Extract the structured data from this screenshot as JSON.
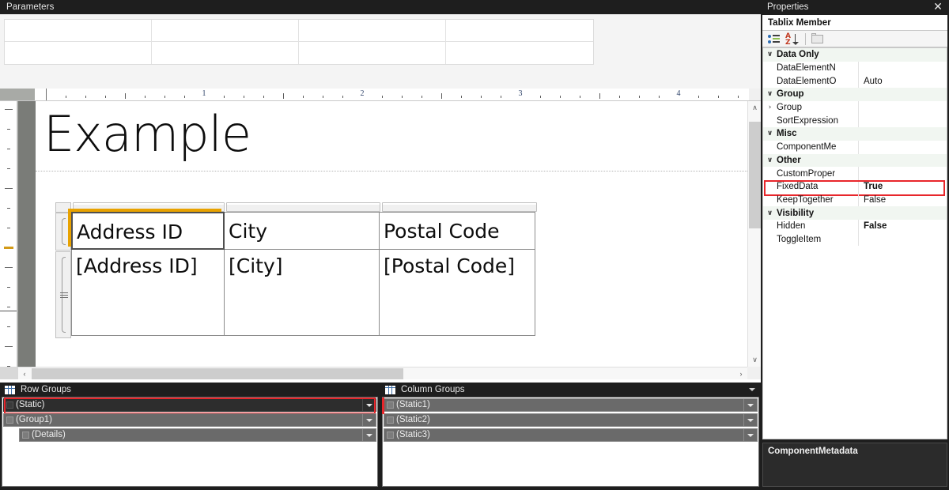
{
  "parameters_pane": {
    "title": "Parameters",
    "grid": {
      "columns": 4,
      "rows": 2,
      "cells": [
        "",
        "",
        "",
        "",
        "",
        "",
        "",
        ""
      ]
    }
  },
  "ruler": {
    "horizontal_labels": [
      "1",
      "2",
      "3",
      "4"
    ],
    "units": "inches"
  },
  "design_surface": {
    "report_title": "Example",
    "tablix": {
      "header_row": [
        "Address ID",
        "City",
        "Postal Code"
      ],
      "detail_row": [
        "[Address ID]",
        "[City]",
        "[Postal Code]"
      ],
      "selected_cell": "Address ID",
      "selection_color": "#e8a200"
    },
    "scrollbars": {
      "vertical_up": "∧",
      "vertical_down": "∨",
      "horizontal_left": "‹",
      "horizontal_right": "›"
    }
  },
  "row_groups": {
    "title": "Row Groups",
    "icon": "grid-icon",
    "rows": [
      {
        "label": "(Static)",
        "selected": true,
        "indent": 0,
        "highlighted": true
      },
      {
        "label": "(Group1)",
        "selected": false,
        "indent": 0,
        "highlighted": false
      },
      {
        "label": "(Details)",
        "selected": false,
        "indent": 1,
        "highlighted": false
      }
    ]
  },
  "column_groups": {
    "title": "Column Groups",
    "icon": "grid-icon",
    "rows": [
      {
        "label": "(Static1)",
        "selected": false,
        "indent": 0,
        "highlighted": false
      },
      {
        "label": "(Static2)",
        "selected": false,
        "indent": 0,
        "highlighted": false
      },
      {
        "label": "(Static3)",
        "selected": false,
        "indent": 0,
        "highlighted": false
      }
    ]
  },
  "properties_panel": {
    "title": "Properties",
    "close_glyph": "✕",
    "subtitle": "Tablix Member",
    "toolbar": {
      "categorized_tooltip": "Categorized",
      "alphabetical_tooltip": "Alphabetical",
      "property_pages_tooltip": "Property Pages"
    },
    "rows": [
      {
        "kind": "category",
        "expander": "∨",
        "name": "Data Only",
        "value": "",
        "bold_value": false,
        "highlighted": false
      },
      {
        "kind": "prop",
        "expander": "",
        "name": "DataElementN",
        "value": "",
        "bold_value": false,
        "highlighted": false
      },
      {
        "kind": "prop",
        "expander": "",
        "name": "DataElementO",
        "value": "Auto",
        "bold_value": false,
        "highlighted": false
      },
      {
        "kind": "category",
        "expander": "∨",
        "name": "Group",
        "value": "",
        "bold_value": false,
        "highlighted": false
      },
      {
        "kind": "prop",
        "expander": "›",
        "name": "Group",
        "value": "",
        "bold_value": false,
        "highlighted": false
      },
      {
        "kind": "prop",
        "expander": "",
        "name": "SortExpression",
        "value": "",
        "bold_value": false,
        "highlighted": false
      },
      {
        "kind": "category",
        "expander": "∨",
        "name": "Misc",
        "value": "",
        "bold_value": false,
        "highlighted": false
      },
      {
        "kind": "prop",
        "expander": "",
        "name": "ComponentMe",
        "value": "",
        "bold_value": false,
        "highlighted": false
      },
      {
        "kind": "category",
        "expander": "∨",
        "name": "Other",
        "value": "",
        "bold_value": false,
        "highlighted": false
      },
      {
        "kind": "prop",
        "expander": "",
        "name": "CustomProper",
        "value": "",
        "bold_value": false,
        "highlighted": false
      },
      {
        "kind": "prop",
        "expander": "",
        "name": "FixedData",
        "value": "True",
        "bold_value": true,
        "highlighted": true
      },
      {
        "kind": "prop",
        "expander": "",
        "name": "KeepTogether",
        "value": "False",
        "bold_value": false,
        "highlighted": false
      },
      {
        "kind": "category",
        "expander": "∨",
        "name": "Visibility",
        "value": "",
        "bold_value": false,
        "highlighted": false
      },
      {
        "kind": "prop",
        "expander": "",
        "name": "Hidden",
        "value": "False",
        "bold_value": true,
        "highlighted": false
      },
      {
        "kind": "prop",
        "expander": "",
        "name": "ToggleItem",
        "value": "",
        "bold_value": false,
        "highlighted": false
      }
    ],
    "description": "ComponentMetadata"
  },
  "colors": {
    "chrome_dark": "#1e1e1e",
    "highlight_red": "#e8262b",
    "selection_orange": "#e8a200",
    "group_row": "#6a6a6a"
  }
}
